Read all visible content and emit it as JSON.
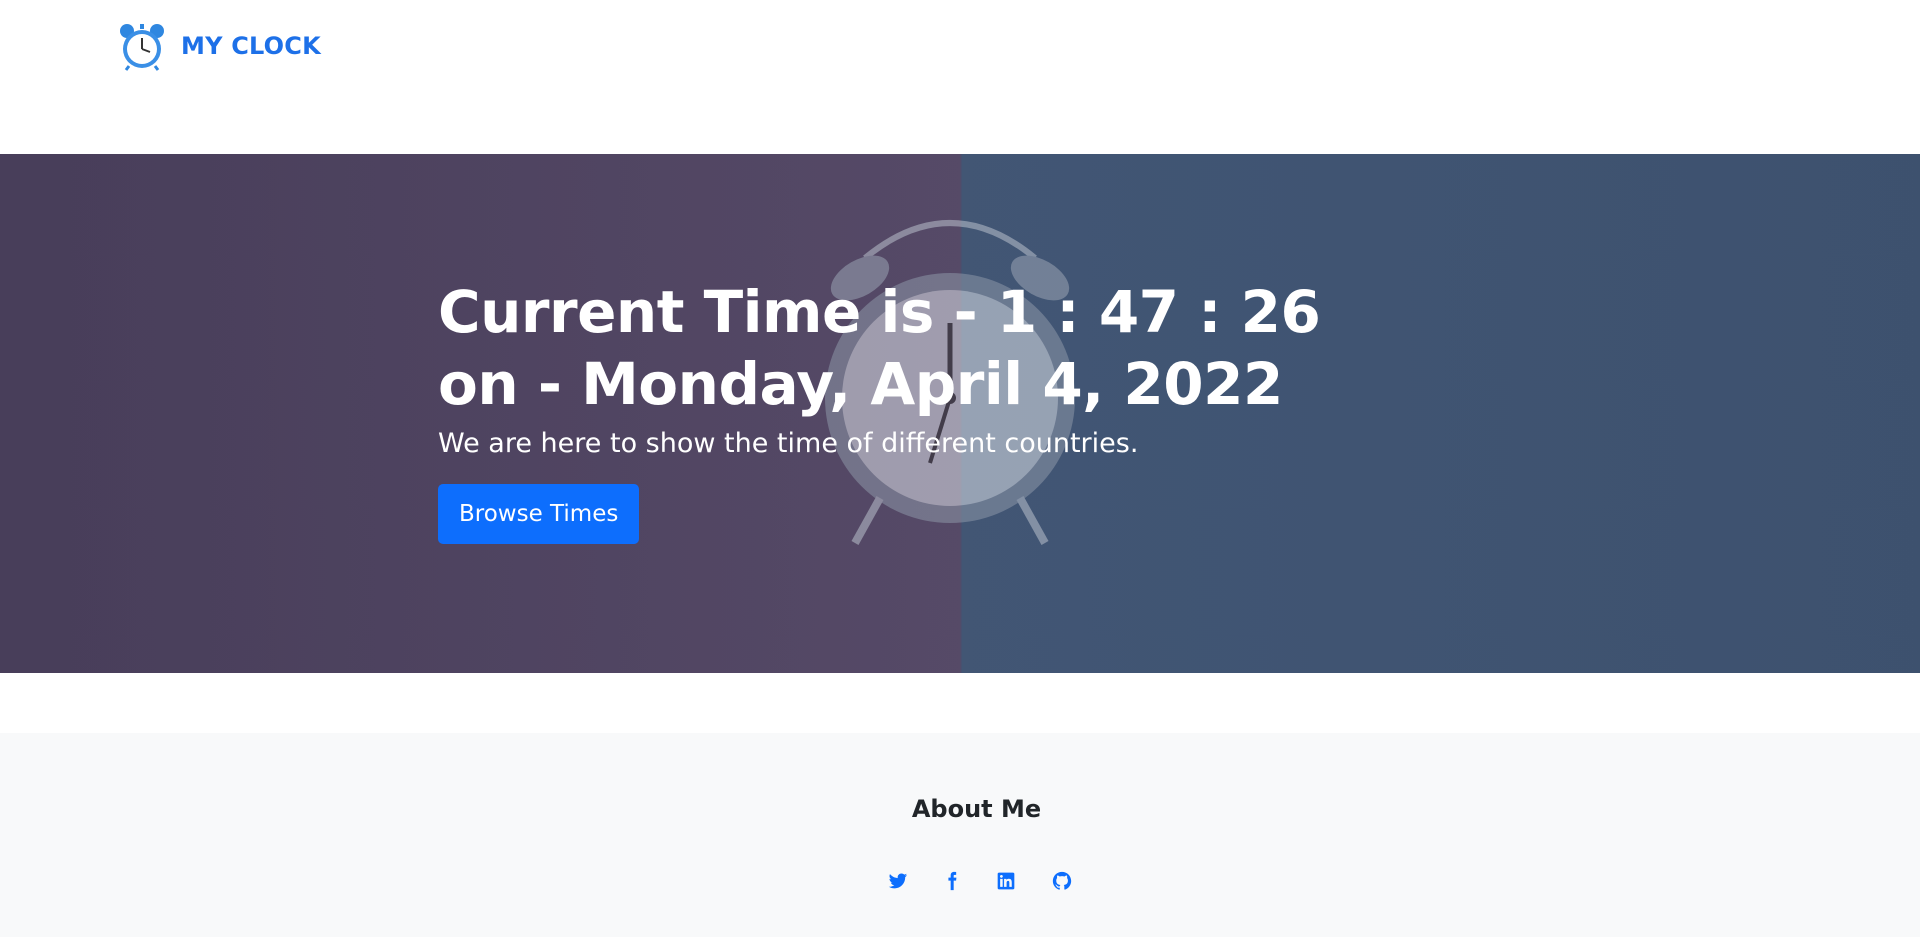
{
  "brand": {
    "name": "MY CLOCK",
    "icon": "alarm-clock-icon"
  },
  "hero": {
    "title_line1": "Current Time is - 1 : 47 : 26",
    "title_line2": "on - Monday, April 4, 2022",
    "subtitle": "We are here to show the time of different countries.",
    "button_label": "Browse Times"
  },
  "about": {
    "title": "About Me",
    "socials": [
      {
        "name": "twitter-icon"
      },
      {
        "name": "facebook-icon"
      },
      {
        "name": "linkedin-icon"
      },
      {
        "name": "github-icon"
      }
    ]
  },
  "colors": {
    "accent": "#0d6efd",
    "brand": "#1d70e8",
    "footer_bg": "#f8f9fa"
  }
}
